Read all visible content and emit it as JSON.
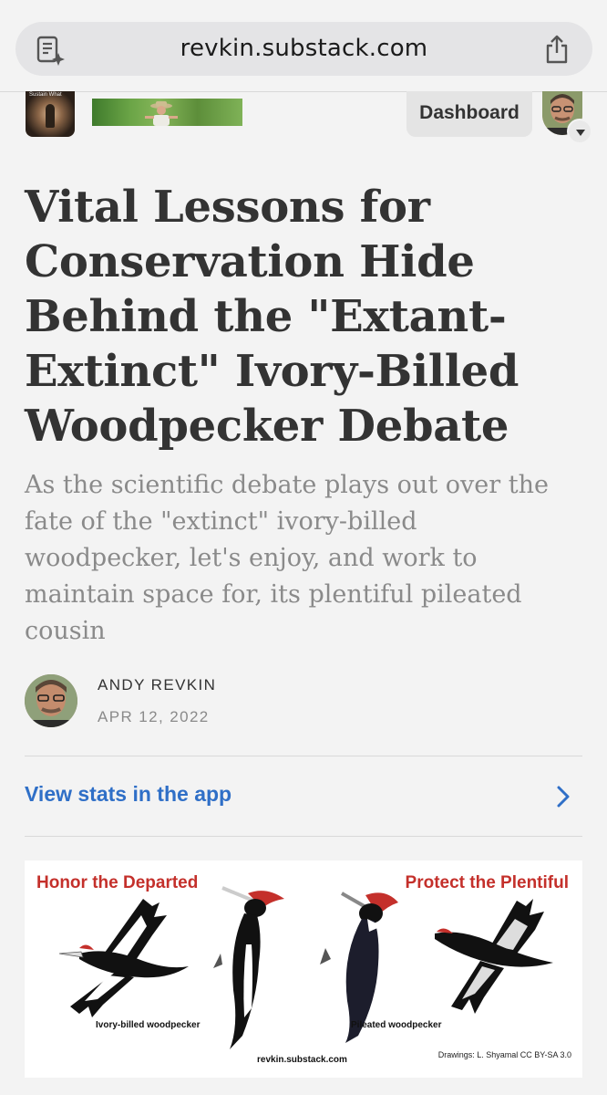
{
  "browser": {
    "url": "revkin.substack.com",
    "reader_icon": "reader-icon",
    "share_icon": "share-icon"
  },
  "header": {
    "logo_text": "Sustain What",
    "dashboard_label": "Dashboard"
  },
  "article": {
    "title": "Vital Lessons for Conservation Hide Behind the \"Extant-Extinct\" Ivory-Billed Woodpecker Debate",
    "subtitle": "As the scientific debate plays out over the fate of the \"extinct\" ivory-billed woodpecker, let's enjoy, and work to maintain space for, its plentiful pileated cousin",
    "author": "ANDY REVKIN",
    "date": "APR 12, 2022",
    "stats_link": "View stats in the app"
  },
  "hero": {
    "left_heading": "Honor the Departed",
    "right_heading": "Protect the Plentiful",
    "left_caption": "Ivory-billed woodpecker",
    "right_caption": "Pileated woodpecker",
    "site_caption": "revkin.substack.com",
    "credit": "Drawings: L. Shyamal CC BY-SA 3.0"
  },
  "colors": {
    "link": "#2f6fc7",
    "hero_heading": "#c4302b",
    "background": "#f3f3f3"
  }
}
